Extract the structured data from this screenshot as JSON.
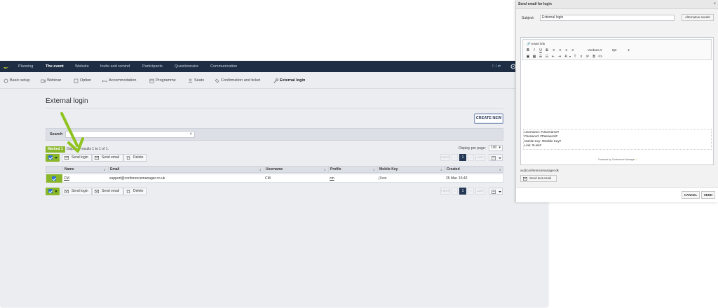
{
  "topnav": {
    "items": [
      "Planning",
      "The event",
      "Website",
      "Invite and remind",
      "Participants",
      "Questionnaire",
      "Communication"
    ],
    "active": "The event",
    "lang": "⚐ / ⇄"
  },
  "subnav": {
    "items": [
      "Basic setup",
      "Webinar",
      "Option",
      "Accommodation",
      "Programme",
      "Seats",
      "Confirmation and ticket",
      "External login"
    ],
    "active": "External login"
  },
  "page": {
    "title": "External login",
    "create_new": "CREATE NEW"
  },
  "search": {
    "label": "Search",
    "value": "",
    "clear": "×"
  },
  "list": {
    "marked_badge": "Marked 1",
    "display_text": "Displays results 1 to 1 of 1.",
    "per_page_label": "Display per page:",
    "per_page_value": "100",
    "pager": {
      "first": "FIRST",
      "prev": "<",
      "current": "1",
      "next": ">",
      "last": "LAST"
    },
    "actions": {
      "send_login": "Send login",
      "send_email": "Send email",
      "delete": "Delete"
    }
  },
  "table": {
    "columns": [
      "Name",
      "Email",
      "Username",
      "Profile",
      "Mobile Key",
      "Created"
    ],
    "rows": [
      {
        "name": "CM",
        "email": "support@conferencemanager.co.uk",
        "username": "CM",
        "profile": "cm",
        "mobile_key": "j7vxx",
        "created": "25 Mar. 15:42"
      }
    ]
  },
  "dialog": {
    "title": "Send email for login",
    "close": "×",
    "subject_label": "Subject:",
    "subject_value": "External login",
    "alt_sender": "Alternative sender",
    "insert_link": "Insert link",
    "font": "Verdana",
    "size": "8pt",
    "content": {
      "username": "Username: #Username#",
      "password": "Password: #Password#",
      "mobile_key": "Mobile Key: #Mobile Key#",
      "link": "Link: #Link#"
    },
    "powered_by": "Powered by Conference Manager",
    "sender_email": "xx@conferencemanager.dk",
    "send_test_email": "Send test email",
    "cancel": "CANCEL",
    "send": "SEND"
  },
  "colors": {
    "nav_bg": "#1e2d44",
    "accent_green": "#8ab72a",
    "checkbox_blue": "#2e6fd1",
    "page_bg": "#ecedf1"
  }
}
